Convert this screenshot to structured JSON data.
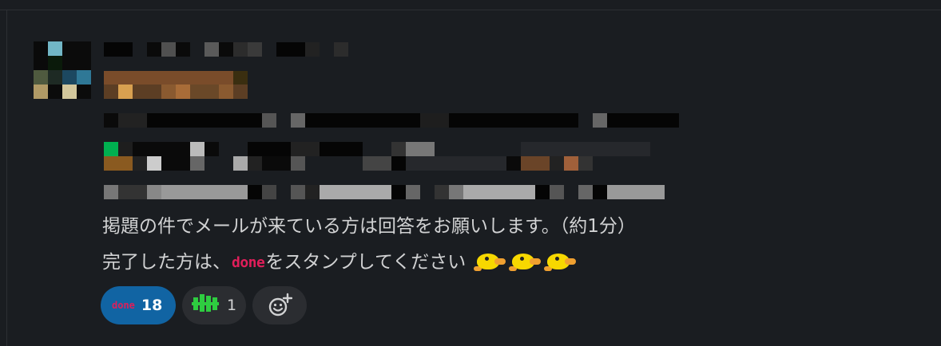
{
  "message": {
    "body_line1": "掲題の件でメールが来ている方は回答をお願いします。（約1分）",
    "body_line2_prefix": "完了した方は、",
    "body_line2_done": "done",
    "body_line2_suffix": "をスタンプしてください",
    "body_line2_emoji": [
      "duck-icon",
      "duck-icon",
      "duck-icon"
    ]
  },
  "reactions": [
    {
      "emoji": "done",
      "count": "18",
      "selected": true
    },
    {
      "emoji": "muscle-icon",
      "count": "1",
      "selected": false
    }
  ],
  "add_reaction_icon": "emoji-add-icon",
  "colors": {
    "background": "#1a1d21",
    "text": "#d1d2d3",
    "reaction_selected": "#1164a3",
    "reaction_default": "#2b2d31",
    "done_pink": "#e01e5a"
  }
}
